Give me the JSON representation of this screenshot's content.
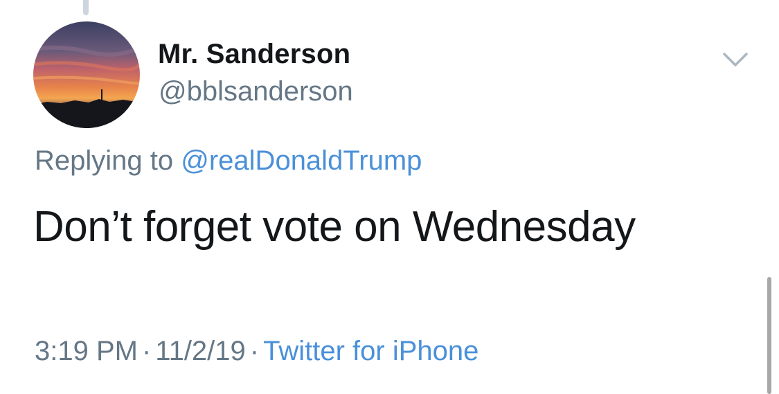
{
  "author": {
    "display_name": "Mr. Sanderson",
    "handle": "@bblsanderson"
  },
  "reply": {
    "prefix": "Replying to",
    "mention": "@realDonaldTrump"
  },
  "tweet": {
    "text": "Don’t forget vote on Wednesday"
  },
  "meta": {
    "time": "3:19 PM",
    "separator": "·",
    "date": "11/2/19",
    "source": "Twitter for iPhone"
  },
  "icons": {
    "menu": "chevron-down-icon",
    "avatar": "sunset-photo"
  },
  "colors": {
    "link": "#4a90d9",
    "secondary_text": "#657786",
    "primary_text": "#14171a"
  }
}
